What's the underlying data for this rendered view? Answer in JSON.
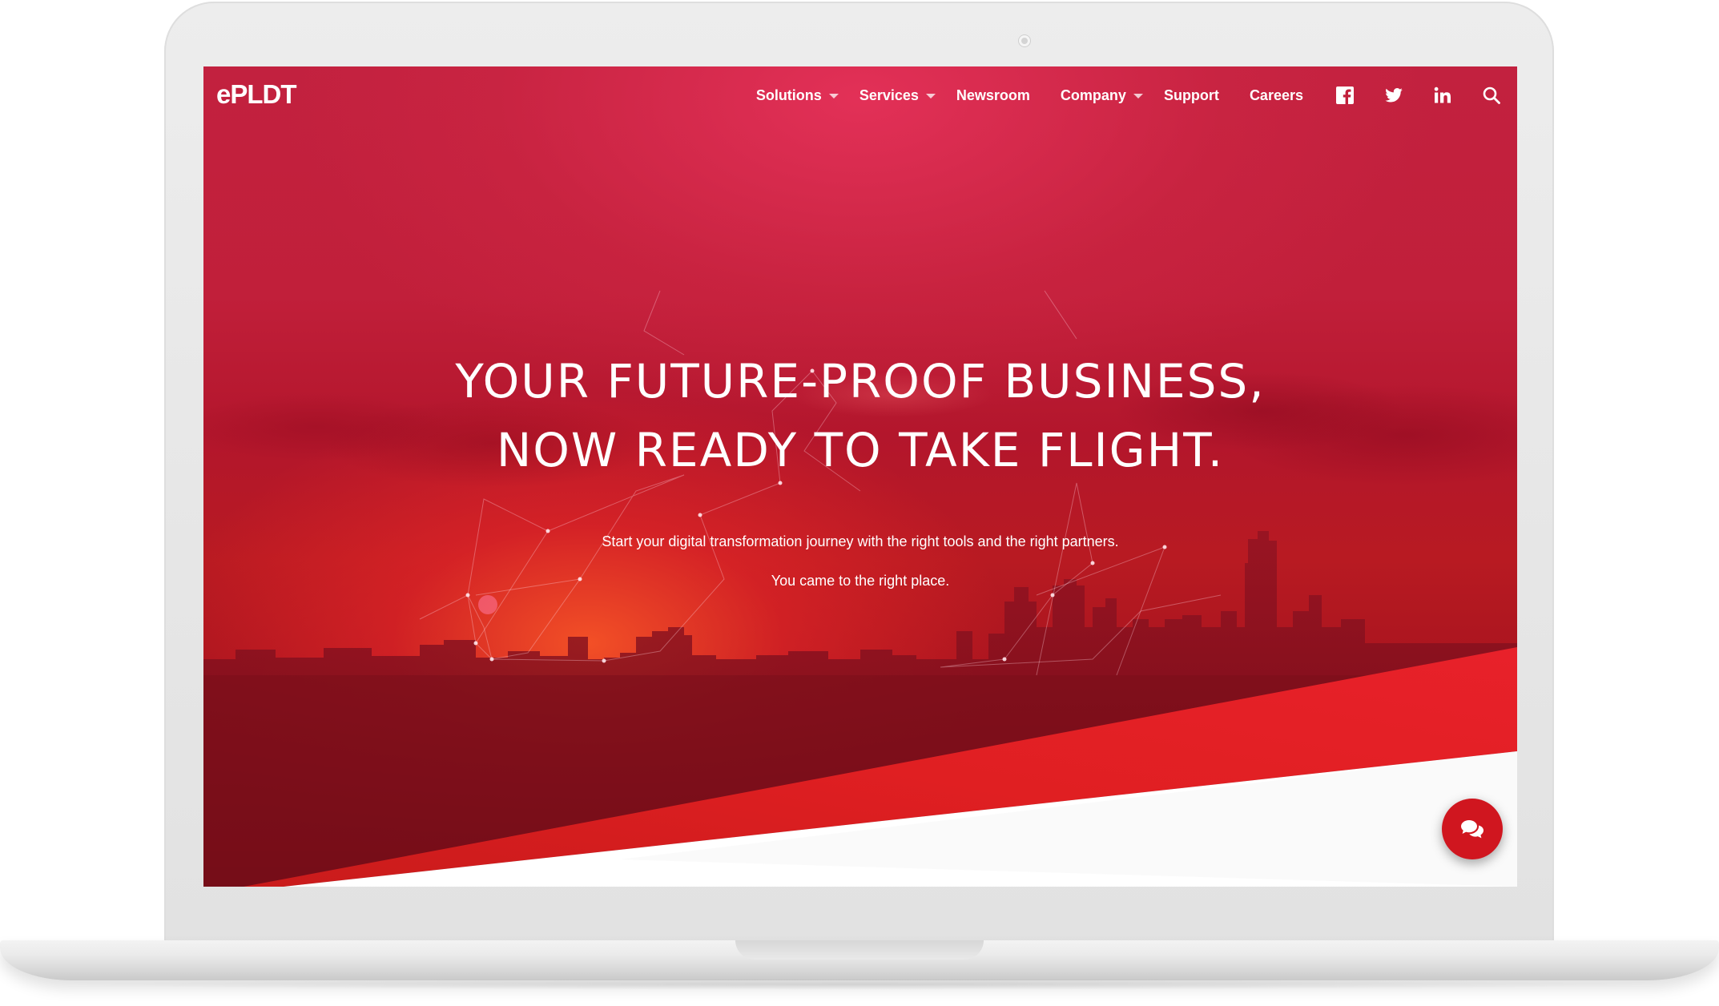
{
  "brand": {
    "logo_text": "ePLDT",
    "primary_color": "#d0161f"
  },
  "nav": {
    "items": [
      {
        "label": "Solutions",
        "has_dropdown": true
      },
      {
        "label": "Services",
        "has_dropdown": true
      },
      {
        "label": "Newsroom",
        "has_dropdown": false
      },
      {
        "label": "Company",
        "has_dropdown": true
      },
      {
        "label": "Support",
        "has_dropdown": false
      },
      {
        "label": "Careers",
        "has_dropdown": false
      }
    ],
    "icons": [
      "facebook-icon",
      "twitter-icon",
      "linkedin-icon",
      "search-icon"
    ]
  },
  "hero": {
    "title_line1": "YOUR FUTURE-PROOF BUSINESS,",
    "title_line2": "NOW READY TO TAKE FLIGHT.",
    "subtitle": "Start your digital transformation journey with the right tools and the right partners.",
    "tagline": "You came to the right place."
  },
  "chat": {
    "icon": "chat-bubbles-icon"
  },
  "device": {
    "frame": "laptop"
  }
}
